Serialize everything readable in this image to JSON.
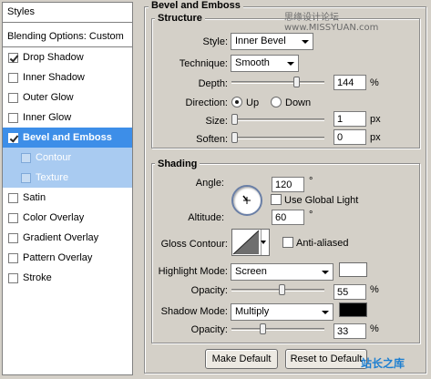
{
  "styles_list": {
    "header": "Styles",
    "blending_options": "Blending Options: Custom",
    "items": [
      {
        "label": "Drop Shadow",
        "checked": true
      },
      {
        "label": "Inner Shadow",
        "checked": false
      },
      {
        "label": "Outer Glow",
        "checked": false
      },
      {
        "label": "Inner Glow",
        "checked": false
      },
      {
        "label": "Bevel and Emboss",
        "checked": true,
        "selected": true
      },
      {
        "label": "Contour",
        "checked": false,
        "sub": true
      },
      {
        "label": "Texture",
        "checked": false,
        "sub": true
      },
      {
        "label": "Satin",
        "checked": false
      },
      {
        "label": "Color Overlay",
        "checked": false
      },
      {
        "label": "Gradient Overlay",
        "checked": false
      },
      {
        "label": "Pattern Overlay",
        "checked": false
      },
      {
        "label": "Stroke",
        "checked": false
      }
    ]
  },
  "bevel": {
    "title": "Bevel and Emboss",
    "structure": {
      "title": "Structure",
      "style_label": "Style:",
      "style_value": "Inner Bevel",
      "technique_label": "Technique:",
      "technique_value": "Smooth",
      "depth_label": "Depth:",
      "depth_value": "144",
      "depth_unit": "%",
      "depth_slider_fraction": 0.72,
      "direction_label": "Direction:",
      "direction_up": "Up",
      "direction_down": "Down",
      "direction_selected": "Up",
      "size_label": "Size:",
      "size_value": "1",
      "size_unit": "px",
      "size_slider_fraction": 0.0,
      "soften_label": "Soften:",
      "soften_value": "0",
      "soften_unit": "px",
      "soften_slider_fraction": 0.0
    },
    "shading": {
      "title": "Shading",
      "angle_label": "Angle:",
      "angle_value": "120",
      "angle_unit": "°",
      "use_global_light": "Use Global Light",
      "use_global_light_checked": false,
      "altitude_label": "Altitude:",
      "altitude_value": "60",
      "altitude_unit": "°",
      "gloss_contour_label": "Gloss Contour:",
      "anti_aliased": "Anti-aliased",
      "anti_aliased_checked": false,
      "highlight_mode_label": "Highlight Mode:",
      "highlight_mode_value": "Screen",
      "highlight_color": "#ffffff",
      "highlight_opacity_label": "Opacity:",
      "highlight_opacity_value": "55",
      "highlight_opacity_unit": "%",
      "highlight_opacity_fraction": 0.55,
      "shadow_mode_label": "Shadow Mode:",
      "shadow_mode_value": "Multiply",
      "shadow_color": "#000000",
      "shadow_opacity_label": "Opacity:",
      "shadow_opacity_value": "33",
      "shadow_opacity_unit": "%",
      "shadow_opacity_fraction": 0.33
    },
    "buttons": {
      "make_default": "Make Default",
      "reset_to_default": "Reset to Default"
    }
  },
  "watermarks": {
    "top_right": "思缘设计论坛 www.MISSYUAN.com",
    "bottom_right": "站长之库"
  },
  "colors": {
    "selected_row": "#3d8ee8",
    "sub_row": "#a9cbf1",
    "panel_bg": "#d4d0c8"
  }
}
